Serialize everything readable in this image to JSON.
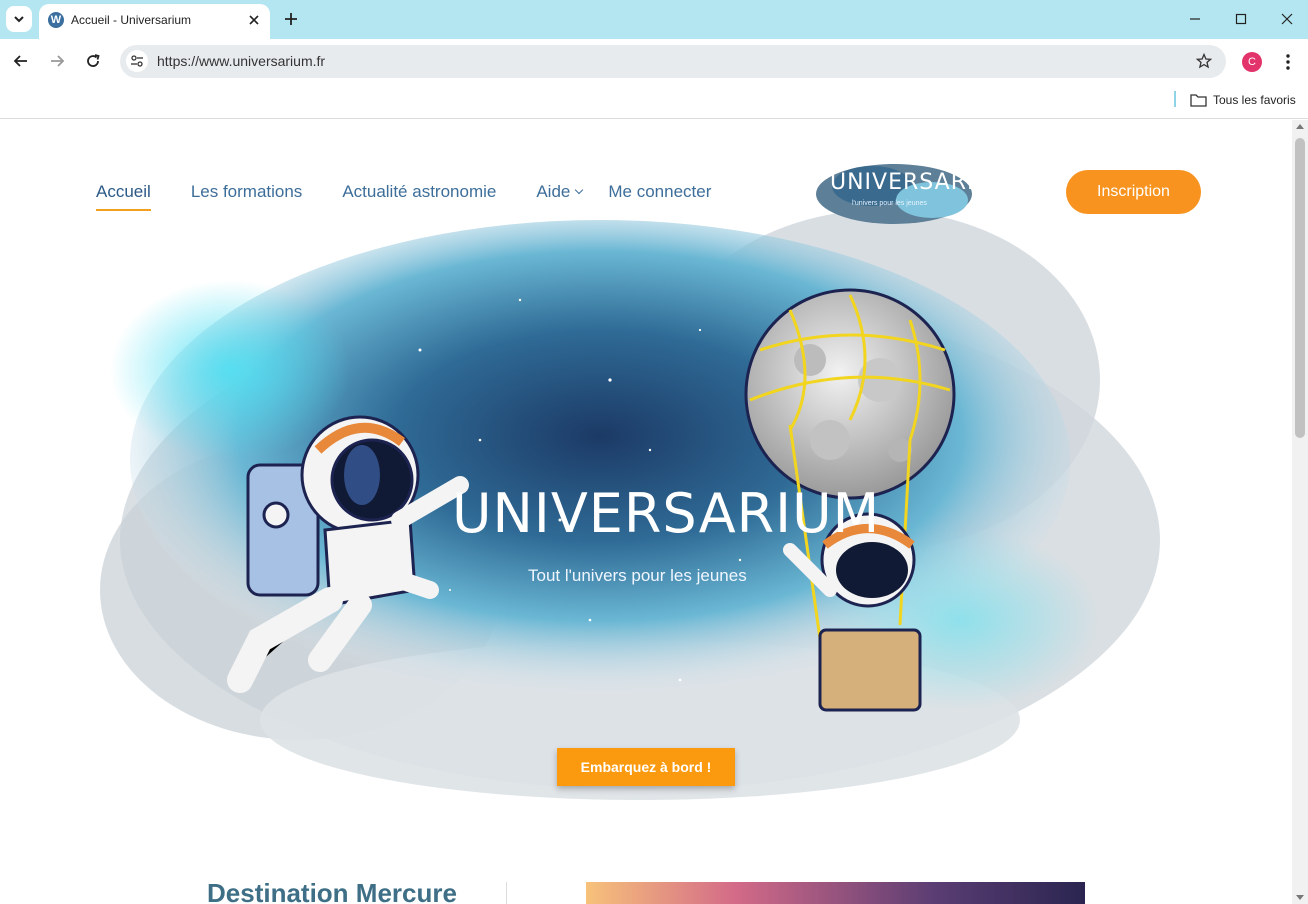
{
  "browser": {
    "tab_title": "Accueil - Universarium",
    "url": "https://www.universarium.fr",
    "profile_initial": "C",
    "bookmarks_label": "Tous les favoris"
  },
  "site": {
    "nav": [
      {
        "label": "Accueil",
        "active": true
      },
      {
        "label": "Les formations"
      },
      {
        "label": "Actualité astronomie"
      },
      {
        "label": "Aide",
        "has_dropdown": true
      },
      {
        "label": "Me connecter"
      }
    ],
    "logo_text": "UNIVERSARIUM.fr",
    "logo_tagline": "l'univers pour les jeunes",
    "signup_label": "Inscription",
    "hero_title": "UNIVERSARIUM",
    "hero_tagline": "Tout l'univers pour les jeunes",
    "hero_cta": "Embarquez à bord !",
    "section_title": "Destination Mercure"
  },
  "colors": {
    "tabbar": "#b3e6f0",
    "nav_text": "#3d6e9a",
    "accent_orange": "#f7931e",
    "active_underline": "#f3a020",
    "section_title": "#3e6f86"
  }
}
